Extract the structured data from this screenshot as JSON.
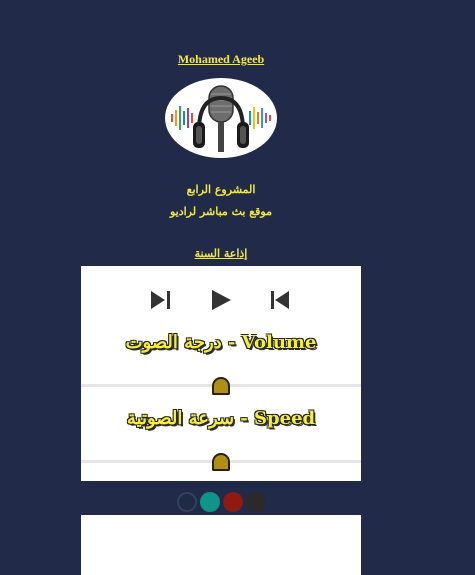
{
  "header": {
    "author": "Mohamed Ageeb",
    "logo_icon": "microphone-headphones-logo",
    "subtitle_line1": "المشروع الرابع",
    "subtitle_line2": "موقع بث مباشر لراديو",
    "station_title": "إذاعة السنة"
  },
  "player": {
    "buttons": [
      {
        "name": "next-track-button",
        "icon": "skip-next-icon"
      },
      {
        "name": "play-button",
        "icon": "play-icon"
      },
      {
        "name": "previous-track-button",
        "icon": "skip-previous-icon"
      }
    ],
    "volume_label": "درجة الصوت - Volume",
    "volume_level": 0.5,
    "speed_label": "سرعة الصوتية - Speed",
    "speed_level": 0.5
  },
  "themes": {
    "colors": [
      "#1f2a44",
      "#0f9488",
      "#8e1a10",
      "#2a2a2a"
    ]
  },
  "colors": {
    "background": "#222a4a",
    "accent_text": "#f2ea3a",
    "panel": "#ffffff",
    "slider_thumb": "#b18f14"
  }
}
